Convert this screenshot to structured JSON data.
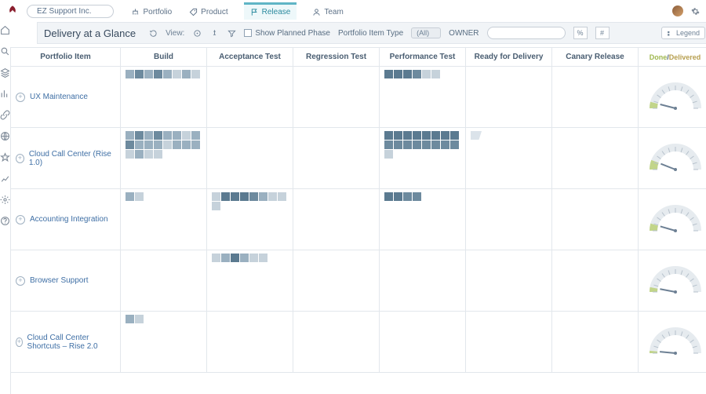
{
  "org_name": "EZ Support Inc.",
  "top_tabs": [
    {
      "label": "Portfolio",
      "icon": "tree-icon"
    },
    {
      "label": "Product",
      "icon": "tag-icon"
    },
    {
      "label": "Release",
      "icon": "flag-icon",
      "active": true
    },
    {
      "label": "Team",
      "icon": "person-icon"
    }
  ],
  "page_title": "Delivery at a Glance",
  "view_label": "View:",
  "show_planned_label": "Show Planned Phase",
  "pitype_label": "Portfolio Item Type",
  "pitype_value": "(All)",
  "owner_label": "OWNER",
  "btn_percent": "%",
  "btn_hash": "#",
  "legend_label": "Legend",
  "columns": {
    "item": "Portfolio Item",
    "stages": [
      "Build",
      "Acceptance Test",
      "Regression Test",
      "Performance Test",
      "Ready for Delivery",
      "Canary Release"
    ],
    "gauge_a": "Done",
    "gauge_sep": " / ",
    "gauge_b": "Delivered"
  },
  "rows": [
    {
      "name": "UX Maintenance",
      "stages": {
        "Build": [
          "l3",
          "l2",
          "l3",
          "l2",
          "l3",
          "l4",
          "l3",
          "l4"
        ],
        "Performance Test": [
          "l1",
          "l1",
          "l1",
          "l2",
          "l4",
          "l4"
        ]
      },
      "gauge_pct": 8
    },
    {
      "name": "Cloud Call Center (Rise 1.0)",
      "stages": {
        "Build": [
          "l3",
          "l2",
          "l3",
          "l2",
          "l3",
          "l3",
          "l4",
          "l3",
          "l2",
          "l3",
          "l3",
          "l3",
          "l4",
          "l3",
          "l3",
          "l3",
          "l4",
          "l3",
          "l4",
          "l4"
        ],
        "Performance Test": [
          "l1",
          "l1",
          "l1",
          "l1",
          "l1",
          "l1",
          "l1",
          "l1",
          "l2",
          "l2",
          "l2",
          "l2",
          "l2",
          "l2",
          "l2",
          "l2",
          "l4"
        ],
        "Ready for Delivery": [
          "flag"
        ]
      },
      "gauge_pct": 12
    },
    {
      "name": "Accounting Integration",
      "stages": {
        "Build": [
          "l3",
          "l4"
        ],
        "Acceptance Test": [
          "l4",
          "l1",
          "l1",
          "l1",
          "l2",
          "l3",
          "l4",
          "l4",
          "l4"
        ],
        "Performance Test": [
          "l1",
          "l1",
          "l2",
          "l2"
        ]
      },
      "gauge_pct": 9
    },
    {
      "name": "Browser Support",
      "stages": {
        "Acceptance Test": [
          "l4",
          "l3",
          "l1",
          "l3",
          "l4",
          "l4"
        ]
      },
      "gauge_pct": 6
    },
    {
      "name": "Cloud Call Center Shortcuts – Rise 2.0",
      "stages": {
        "Build": [
          "l3",
          "l4"
        ]
      },
      "gauge_pct": 3
    }
  ],
  "rail_icons": [
    "home-icon",
    "search-icon",
    "layers-icon",
    "barchart-icon",
    "link-icon",
    "globe-icon",
    "star-icon",
    "analytics-icon",
    "gear-icon",
    "help-icon"
  ]
}
